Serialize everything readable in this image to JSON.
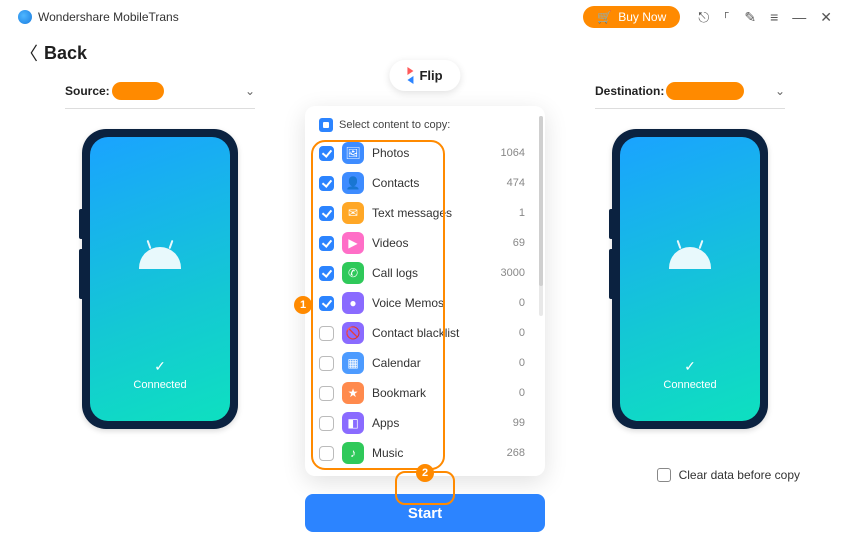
{
  "app": {
    "title": "Wondershare MobileTrans",
    "buy_now": "Buy Now"
  },
  "back": {
    "label": "Back"
  },
  "flip": {
    "label": "Flip"
  },
  "source": {
    "label": "Source:"
  },
  "destination": {
    "label": "Destination:"
  },
  "phone": {
    "status": "Connected"
  },
  "panel": {
    "select_label": "Select content to copy:",
    "items": [
      {
        "name": "Photos",
        "count": "1064",
        "checked": true,
        "color": "#3e8cff",
        "glyph": "🖼"
      },
      {
        "name": "Contacts",
        "count": "474",
        "checked": true,
        "color": "#3e8cff",
        "glyph": "👤"
      },
      {
        "name": "Text messages",
        "count": "1",
        "checked": true,
        "color": "#ffa726",
        "glyph": "✉"
      },
      {
        "name": "Videos",
        "count": "69",
        "checked": true,
        "color": "#ff6ec7",
        "glyph": "▶"
      },
      {
        "name": "Call logs",
        "count": "3000",
        "checked": true,
        "color": "#2fc95a",
        "glyph": "✆"
      },
      {
        "name": "Voice Memos",
        "count": "0",
        "checked": true,
        "color": "#8a6bff",
        "glyph": "●"
      },
      {
        "name": "Contact blacklist",
        "count": "0",
        "checked": false,
        "color": "#8a6bff",
        "glyph": "🚫"
      },
      {
        "name": "Calendar",
        "count": "0",
        "checked": false,
        "color": "#4d9bff",
        "glyph": "▦"
      },
      {
        "name": "Bookmark",
        "count": "0",
        "checked": false,
        "color": "#ff8a4d",
        "glyph": "★"
      },
      {
        "name": "Apps",
        "count": "99",
        "checked": false,
        "color": "#8a6bff",
        "glyph": "◧"
      },
      {
        "name": "Music",
        "count": "268",
        "checked": false,
        "color": "#2fc95a",
        "glyph": "♪"
      }
    ]
  },
  "annotations": {
    "step1": "1",
    "step2": "2"
  },
  "start": {
    "label": "Start"
  },
  "clear": {
    "label": "Clear data before copy"
  }
}
